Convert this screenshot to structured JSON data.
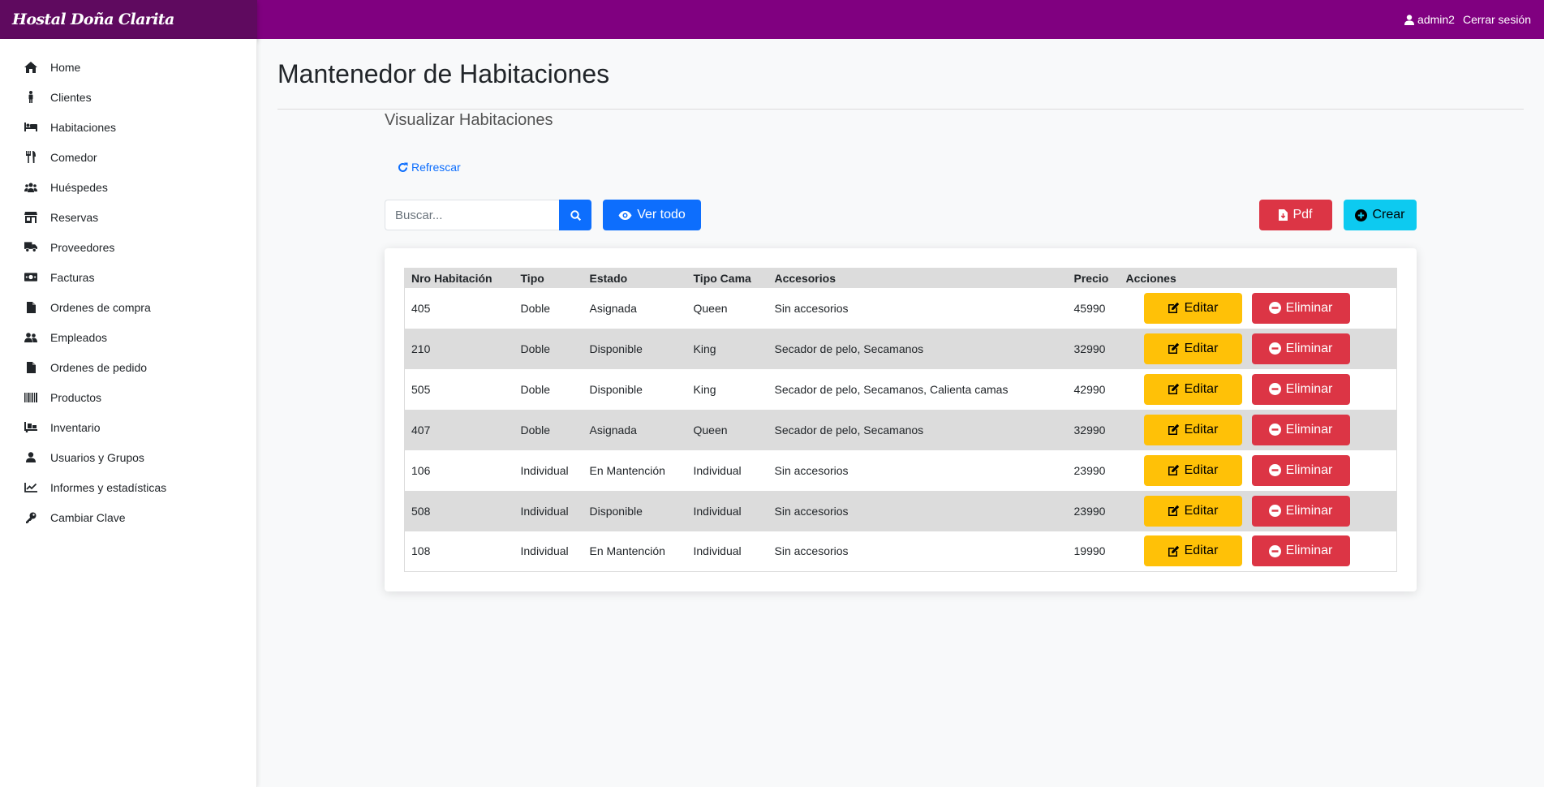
{
  "brand": "Hostal Doña Clarita",
  "topbar": {
    "user": "admin2",
    "logout": "Cerrar sesión"
  },
  "sidebar": {
    "items": [
      {
        "label": "Home",
        "icon": "home-icon"
      },
      {
        "label": "Clientes",
        "icon": "person-icon"
      },
      {
        "label": "Habitaciones",
        "icon": "bed-icon"
      },
      {
        "label": "Comedor",
        "icon": "utensils-icon"
      },
      {
        "label": "Huéspedes",
        "icon": "users-icon"
      },
      {
        "label": "Reservas",
        "icon": "store-icon"
      },
      {
        "label": "Proveedores",
        "icon": "truck-icon"
      },
      {
        "label": "Facturas",
        "icon": "money-bill-icon"
      },
      {
        "label": "Ordenes de compra",
        "icon": "file-icon"
      },
      {
        "label": "Empleados",
        "icon": "user-friends-icon"
      },
      {
        "label": "Ordenes de pedido",
        "icon": "file-icon"
      },
      {
        "label": "Productos",
        "icon": "barcode-icon"
      },
      {
        "label": "Inventario",
        "icon": "dolly-icon"
      },
      {
        "label": "Usuarios y Grupos",
        "icon": "user-icon"
      },
      {
        "label": "Informes y estadísticas",
        "icon": "chart-line-icon"
      },
      {
        "label": "Cambiar Clave",
        "icon": "key-icon"
      }
    ]
  },
  "main": {
    "title": "Mantenedor de Habitaciones",
    "subtitle": "Visualizar Habitaciones",
    "refresh": "Refrescar",
    "search": {
      "placeholder": "Buscar..."
    },
    "buttons": {
      "ver_todo": "Ver todo",
      "pdf": "Pdf",
      "crear": "Crear",
      "editar": "Editar",
      "eliminar": "Eliminar"
    },
    "table": {
      "headers": [
        "Nro Habitación",
        "Tipo",
        "Estado",
        "Tipo Cama",
        "Accesorios",
        "Precio",
        "Acciones"
      ],
      "rows": [
        [
          "405",
          "Doble",
          "Asignada",
          "Queen",
          "Sin accesorios",
          "45990"
        ],
        [
          "210",
          "Doble",
          "Disponible",
          "King",
          "Secador de pelo, Secamanos",
          "32990"
        ],
        [
          "505",
          "Doble",
          "Disponible",
          "King",
          "Secador de pelo, Secamanos, Calienta camas",
          "42990"
        ],
        [
          "407",
          "Doble",
          "Asignada",
          "Queen",
          "Secador de pelo, Secamanos",
          "32990"
        ],
        [
          "106",
          "Individual",
          "En Mantención",
          "Individual",
          "Sin accesorios",
          "23990"
        ],
        [
          "508",
          "Individual",
          "Disponible",
          "Individual",
          "Sin accesorios",
          "23990"
        ],
        [
          "108",
          "Individual",
          "En Mantención",
          "Individual",
          "Sin accesorios",
          "19990"
        ]
      ]
    }
  },
  "colors": {
    "topbar": "#800080",
    "brand_bg": "#5f0a5f",
    "primary": "#0d6efd",
    "danger": "#dc3545",
    "warning": "#ffc107",
    "info": "#0dcaf0"
  }
}
